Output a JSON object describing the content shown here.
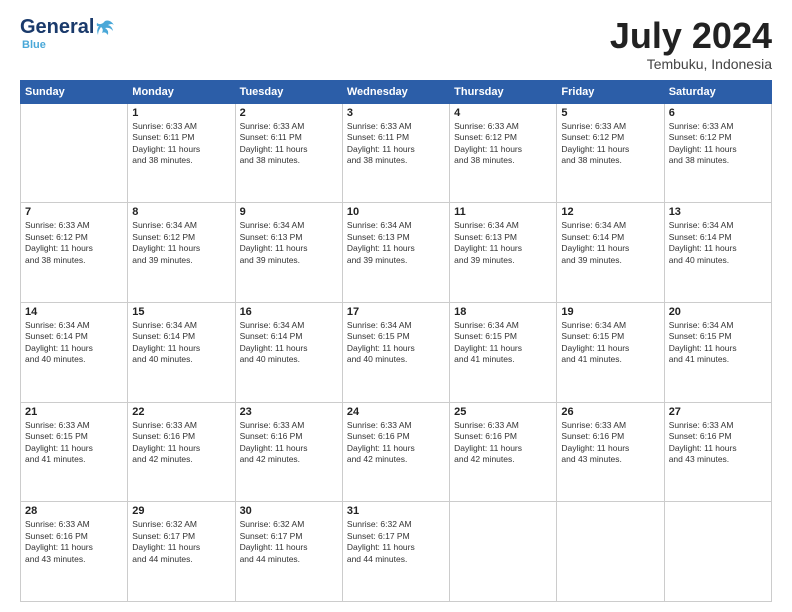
{
  "header": {
    "logo_general": "General",
    "logo_blue": "Blue",
    "month_title": "July 2024",
    "location": "Tembuku, Indonesia"
  },
  "days_of_week": [
    "Sunday",
    "Monday",
    "Tuesday",
    "Wednesday",
    "Thursday",
    "Friday",
    "Saturday"
  ],
  "weeks": [
    [
      {
        "day": "",
        "info": ""
      },
      {
        "day": "1",
        "info": "Sunrise: 6:33 AM\nSunset: 6:11 PM\nDaylight: 11 hours\nand 38 minutes."
      },
      {
        "day": "2",
        "info": "Sunrise: 6:33 AM\nSunset: 6:11 PM\nDaylight: 11 hours\nand 38 minutes."
      },
      {
        "day": "3",
        "info": "Sunrise: 6:33 AM\nSunset: 6:11 PM\nDaylight: 11 hours\nand 38 minutes."
      },
      {
        "day": "4",
        "info": "Sunrise: 6:33 AM\nSunset: 6:12 PM\nDaylight: 11 hours\nand 38 minutes."
      },
      {
        "day": "5",
        "info": "Sunrise: 6:33 AM\nSunset: 6:12 PM\nDaylight: 11 hours\nand 38 minutes."
      },
      {
        "day": "6",
        "info": "Sunrise: 6:33 AM\nSunset: 6:12 PM\nDaylight: 11 hours\nand 38 minutes."
      }
    ],
    [
      {
        "day": "7",
        "info": ""
      },
      {
        "day": "8",
        "info": "Sunrise: 6:34 AM\nSunset: 6:12 PM\nDaylight: 11 hours\nand 39 minutes."
      },
      {
        "day": "9",
        "info": "Sunrise: 6:34 AM\nSunset: 6:13 PM\nDaylight: 11 hours\nand 39 minutes."
      },
      {
        "day": "10",
        "info": "Sunrise: 6:34 AM\nSunset: 6:13 PM\nDaylight: 11 hours\nand 39 minutes."
      },
      {
        "day": "11",
        "info": "Sunrise: 6:34 AM\nSunset: 6:13 PM\nDaylight: 11 hours\nand 39 minutes."
      },
      {
        "day": "12",
        "info": "Sunrise: 6:34 AM\nSunset: 6:14 PM\nDaylight: 11 hours\nand 39 minutes."
      },
      {
        "day": "13",
        "info": "Sunrise: 6:34 AM\nSunset: 6:14 PM\nDaylight: 11 hours\nand 40 minutes."
      }
    ],
    [
      {
        "day": "14",
        "info": ""
      },
      {
        "day": "15",
        "info": "Sunrise: 6:34 AM\nSunset: 6:14 PM\nDaylight: 11 hours\nand 40 minutes."
      },
      {
        "day": "16",
        "info": "Sunrise: 6:34 AM\nSunset: 6:14 PM\nDaylight: 11 hours\nand 40 minutes."
      },
      {
        "day": "17",
        "info": "Sunrise: 6:34 AM\nSunset: 6:15 PM\nDaylight: 11 hours\nand 40 minutes."
      },
      {
        "day": "18",
        "info": "Sunrise: 6:34 AM\nSunset: 6:15 PM\nDaylight: 11 hours\nand 41 minutes."
      },
      {
        "day": "19",
        "info": "Sunrise: 6:34 AM\nSunset: 6:15 PM\nDaylight: 11 hours\nand 41 minutes."
      },
      {
        "day": "20",
        "info": "Sunrise: 6:34 AM\nSunset: 6:15 PM\nDaylight: 11 hours\nand 41 minutes."
      }
    ],
    [
      {
        "day": "21",
        "info": ""
      },
      {
        "day": "22",
        "info": "Sunrise: 6:33 AM\nSunset: 6:16 PM\nDaylight: 11 hours\nand 42 minutes."
      },
      {
        "day": "23",
        "info": "Sunrise: 6:33 AM\nSunset: 6:16 PM\nDaylight: 11 hours\nand 42 minutes."
      },
      {
        "day": "24",
        "info": "Sunrise: 6:33 AM\nSunset: 6:16 PM\nDaylight: 11 hours\nand 42 minutes."
      },
      {
        "day": "25",
        "info": "Sunrise: 6:33 AM\nSunset: 6:16 PM\nDaylight: 11 hours\nand 42 minutes."
      },
      {
        "day": "26",
        "info": "Sunrise: 6:33 AM\nSunset: 6:16 PM\nDaylight: 11 hours\nand 43 minutes."
      },
      {
        "day": "27",
        "info": "Sunrise: 6:33 AM\nSunset: 6:16 PM\nDaylight: 11 hours\nand 43 minutes."
      }
    ],
    [
      {
        "day": "28",
        "info": ""
      },
      {
        "day": "29",
        "info": "Sunrise: 6:32 AM\nSunset: 6:17 PM\nDaylight: 11 hours\nand 44 minutes."
      },
      {
        "day": "30",
        "info": "Sunrise: 6:32 AM\nSunset: 6:17 PM\nDaylight: 11 hours\nand 44 minutes."
      },
      {
        "day": "31",
        "info": "Sunrise: 6:32 AM\nSunset: 6:17 PM\nDaylight: 11 hours\nand 44 minutes."
      },
      {
        "day": "",
        "info": ""
      },
      {
        "day": "",
        "info": ""
      },
      {
        "day": "",
        "info": ""
      }
    ]
  ],
  "week1_day7_info": "Sunrise: 6:33 AM\nSunset: 6:12 PM\nDaylight: 11 hours\nand 38 minutes.",
  "week2_day14_info": "Sunrise: 6:34 AM\nSunset: 6:14 PM\nDaylight: 11 hours\nand 40 minutes.",
  "week3_day21_info": "Sunrise: 6:33 AM\nSunset: 6:15 PM\nDaylight: 11 hours\nand 41 minutes.",
  "week4_day28_info": "Sunrise: 6:33 AM\nSunset: 6:16 PM\nDaylight: 11 hours\nand 43 minutes."
}
